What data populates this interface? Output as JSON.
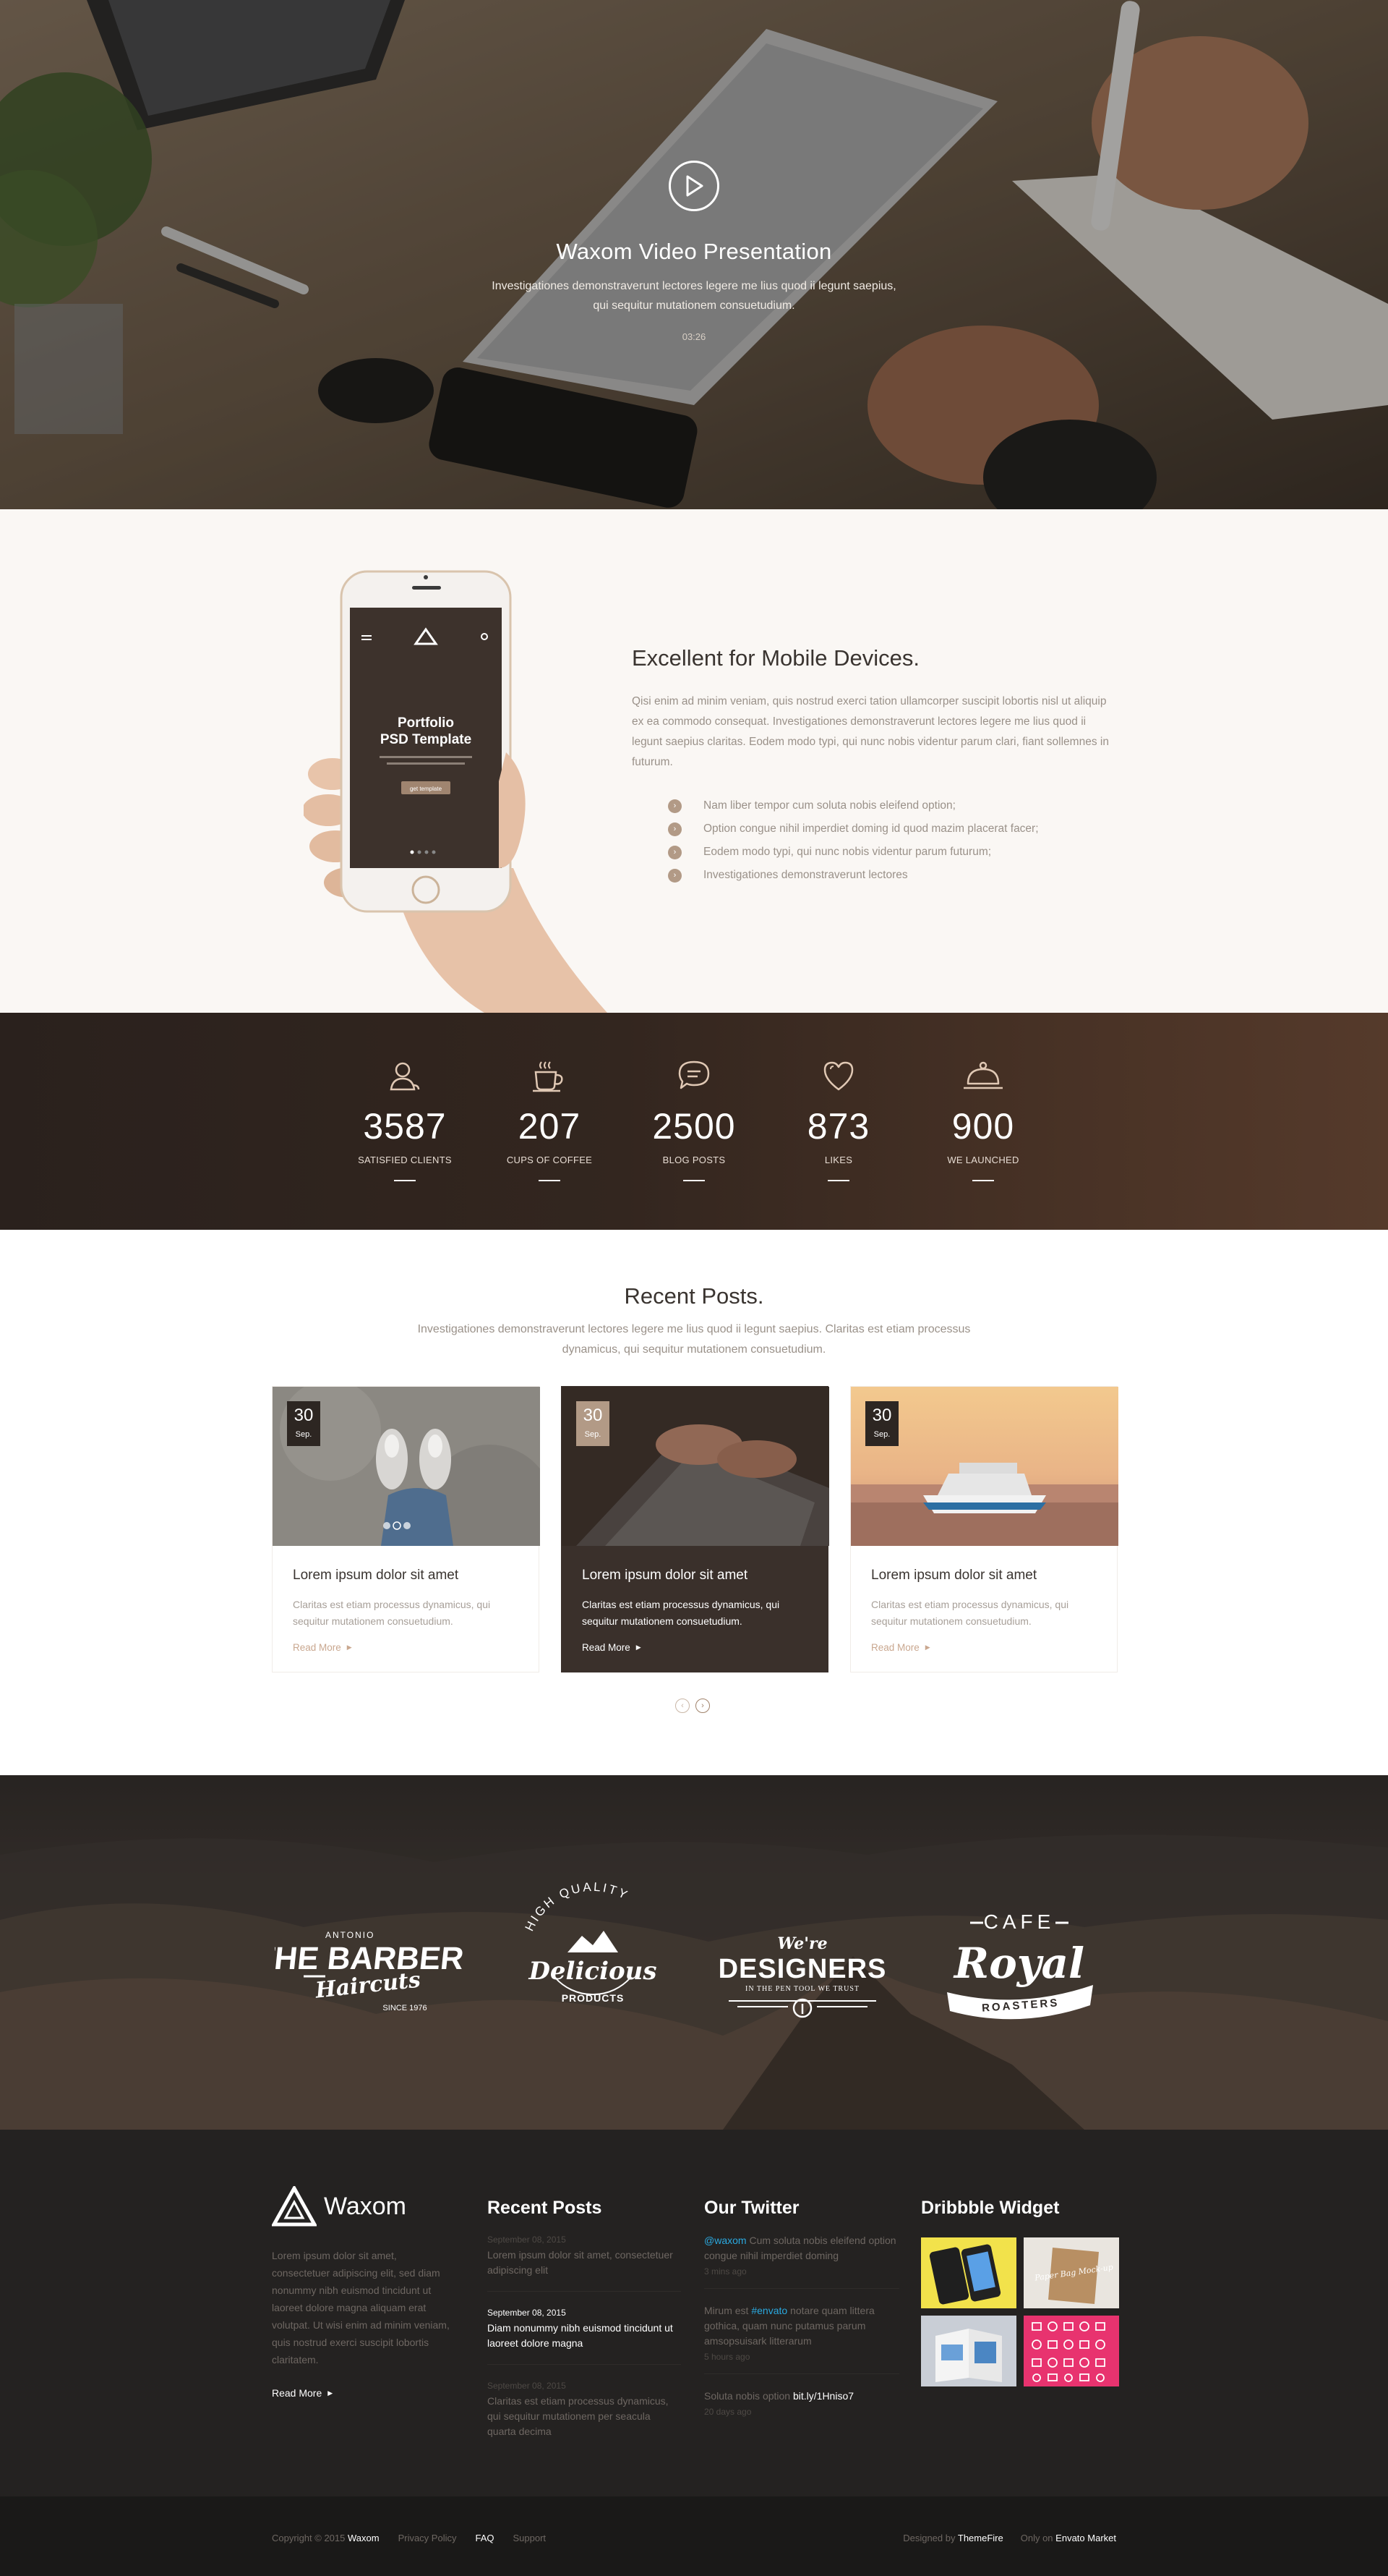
{
  "hero": {
    "title": "Waxom Video Presentation",
    "text": "Investigationes demonstraverunt lectores legere me lius quod ii legunt saepius, qui sequitur mutationem consuetudium.",
    "duration": "03:26"
  },
  "mobile": {
    "title": "Excellent for Mobile Devices.",
    "text": "Qisi enim ad minim veniam, quis nostrud exerci tation ullamcorper suscipit lobortis nisl ut aliquip ex ea commodo consequat. Investigationes demonstraverunt lectores legere me lius quod ii legunt saepius claritas. Eodem modo typi, qui nunc nobis videntur parum clari, fiant sollemnes in futurum.",
    "features": [
      "Nam liber tempor cum soluta nobis eleifend option;",
      "Option congue nihil imperdiet doming id quod mazim placerat facer;",
      "Eodem modo typi, qui nunc nobis videntur parum futurum;",
      "Investigationes demonstraverunt lectores"
    ],
    "phone_screen": {
      "title_line1": "Portfolio",
      "title_line2": "PSD Template",
      "button": "get template"
    }
  },
  "stats": [
    {
      "icon": "user-icon",
      "value": "3587",
      "label": "SATISFIED CLIENTS"
    },
    {
      "icon": "coffee-cup-icon",
      "value": "207",
      "label": "CUPS OF COFFEE"
    },
    {
      "icon": "chat-bubble-icon",
      "value": "2500",
      "label": "BLOG POSTS"
    },
    {
      "icon": "heart-icon",
      "value": "873",
      "label": "LIKES"
    },
    {
      "icon": "cloche-icon",
      "value": "900",
      "label": "WE LAUNCHED"
    }
  ],
  "posts": {
    "title": "Recent Posts.",
    "subtitle": "Investigationes demonstraverunt lectores legere me lius quod ii legunt saepius. Claritas est etiam processus dynamicus, qui sequitur mutationem consuetudium.",
    "items": [
      {
        "day": "30",
        "month": "Sep.",
        "title": "Lorem ipsum dolor sit amet",
        "text": "Claritas est etiam processus dynamicus, qui sequitur mutationem consuetudium.",
        "more": "Read More"
      },
      {
        "day": "30",
        "month": "Sep.",
        "title": "Lorem ipsum dolor sit amet",
        "text": "Claritas est etiam processus dynamicus, qui sequitur mutationem consuetudium.",
        "more": "Read More"
      },
      {
        "day": "30",
        "month": "Sep.",
        "title": "Lorem ipsum dolor sit amet",
        "text": "Claritas est etiam processus dynamicus, qui sequitur mutationem consuetudium.",
        "more": "Read More"
      }
    ]
  },
  "clients": {
    "barber": {
      "top": "ANTONIO",
      "main": "THE BARBER",
      "script": "Haircuts",
      "bottom": "SINCE 1976"
    },
    "delicious": {
      "top": "HIGH QUALITY",
      "main": "Delicious",
      "bottom": "PRODUCTS"
    },
    "designers": {
      "top": "We're",
      "main": "DESIGNERS",
      "bottom": "IN THE PEN TOOL WE TRUST"
    },
    "cafe": {
      "top": "CAFE",
      "main": "Royal",
      "bottom": "ROASTERS"
    }
  },
  "footer": {
    "brand": "Waxom",
    "about": "Lorem ipsum dolor sit amet, consectetuer adipiscing elit, sed diam nonummy nibh euismod tincidunt ut laoreet dolore magna aliquam erat volutpat. Ut wisi enim ad minim veniam, quis nostrud exerci suscipit lobortis claritatem.",
    "read_more": "Read More",
    "posts_title": "Recent Posts",
    "posts": [
      {
        "date": "September 08, 2015",
        "title": "Lorem ipsum dolor sit amet, consectetuer adipiscing elit"
      },
      {
        "date": "September 08, 2015",
        "title": "Diam nonummy nibh euismod tincidunt ut laoreet dolore magna"
      },
      {
        "date": "September 08, 2015",
        "title": "Claritas est etiam processus dynamicus, qui sequitur mutationem per seacula quarta decima"
      }
    ],
    "twitter_title": "Our Twitter",
    "tweets": [
      {
        "handle": "@waxom",
        "text": " Cum soluta nobis eleifend option congue nihil imperdiet doming",
        "time": "3 mins ago"
      },
      {
        "pre": "Mirum est ",
        "handle": "#envato",
        "text": " notare quam littera gothica, quam nunc putamus parum amsopsuisark litterarum",
        "time": "5 hours ago"
      },
      {
        "pre": "Soluta nobis option ",
        "link": "bit.ly/1Hniso7",
        "time": "20 days ago"
      }
    ],
    "dribbble_title": "Dribbble Widget",
    "dribbble_shots": [
      {
        "label": ""
      },
      {
        "label": "Paper Bag Mock-up"
      },
      {
        "label": ""
      },
      {
        "label": ""
      }
    ]
  },
  "bottom": {
    "copyright": "Copyright © 2015",
    "brand": "Waxom",
    "links": [
      "Privacy Policy",
      "FAQ",
      "Support"
    ],
    "designed_by": "Designed by",
    "designer": "ThemeFire",
    "only_on": "Only on",
    "market": "Envato Market"
  }
}
